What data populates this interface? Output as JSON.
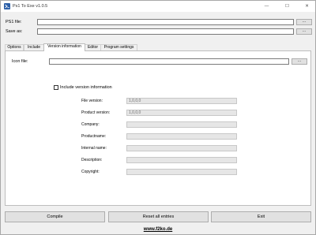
{
  "window": {
    "title": "Ps1 To Exe v1.0.5",
    "min_glyph": "—",
    "max_glyph": "☐",
    "close_glyph": "✕",
    "app_icon": "powershell-icon"
  },
  "top": {
    "ps1_label": "PS1 file:",
    "ps1_value": "",
    "saveas_label": "Save as:",
    "saveas_value": "",
    "browse_label": "..."
  },
  "tabs": [
    {
      "label": "Options"
    },
    {
      "label": "Include"
    },
    {
      "label": "Version information"
    },
    {
      "label": "Editor"
    },
    {
      "label": "Program settings"
    }
  ],
  "active_tab": "Version information",
  "version_info": {
    "icon_label": "Icon file:",
    "icon_value": "",
    "include_label": "Include version information",
    "include_checked": false,
    "fields": [
      {
        "label": "File version:",
        "value": "1,0,0,0"
      },
      {
        "label": "Product version:",
        "value": "1,0,0,0"
      },
      {
        "label": "Company:",
        "value": ""
      },
      {
        "label": "Productname:",
        "value": ""
      },
      {
        "label": "Internal name:",
        "value": ""
      },
      {
        "label": "Description:",
        "value": ""
      },
      {
        "label": "Copyright:",
        "value": ""
      }
    ]
  },
  "buttons": {
    "compile": "Compile",
    "reset": "Reset all entries",
    "exit": "Exit"
  },
  "footer": {
    "link": "www.f2ko.de"
  }
}
